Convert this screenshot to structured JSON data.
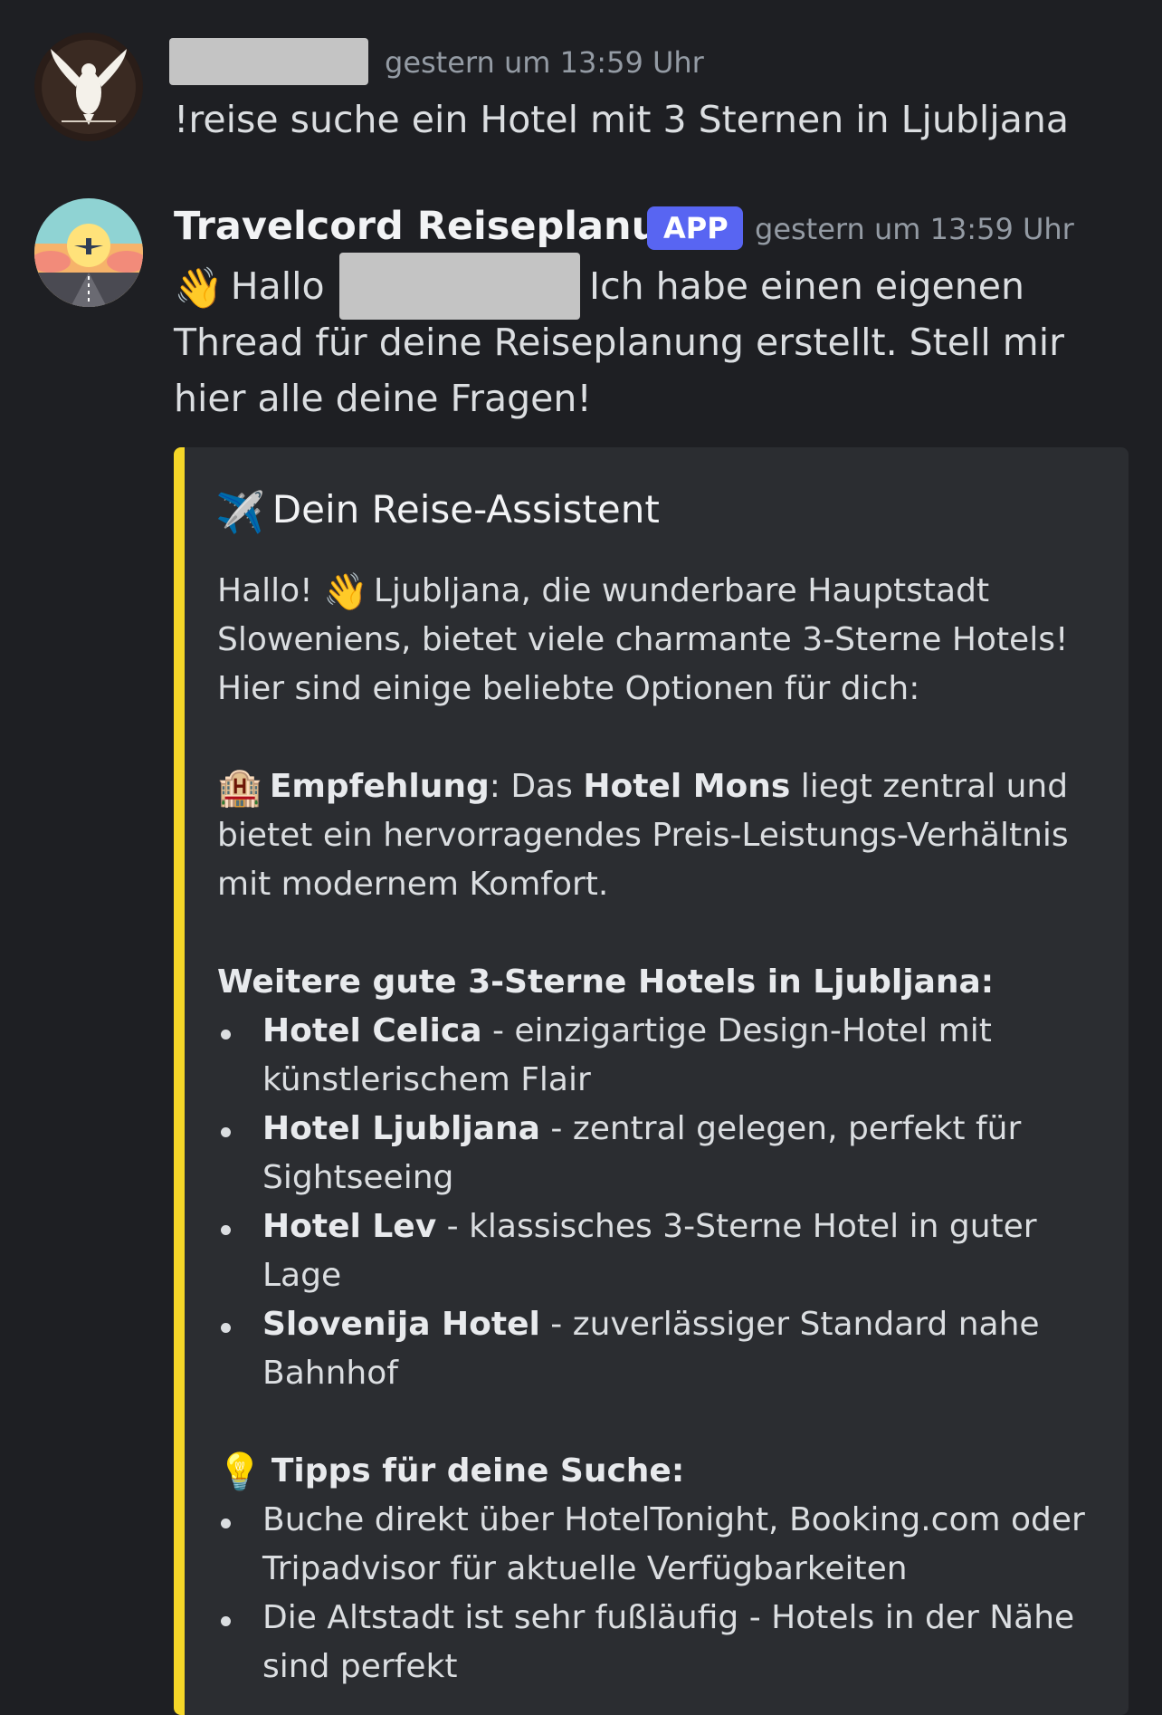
{
  "messages": [
    {
      "author": "",
      "author_redacted": true,
      "timestamp": "gestern um 13:59 Uhr",
      "text": "!reise suche ein Hotel mit 3 Sternen in Ljubljana"
    },
    {
      "author": "Travelcord Reiseplanung",
      "badge": "APP",
      "timestamp": "gestern um 13:59 Uhr",
      "line1_pre": "Hallo",
      "line1_post": "Ich habe einen eigenen",
      "line2": "Thread für deine Reiseplanung erstellt. Stell mir",
      "line3": "hier alle deine Fragen!"
    }
  ],
  "embed": {
    "accent_color": "#f5d628",
    "title": "Dein Reise-Assistent",
    "intro": [
      "Hallo! ",
      "Ljubljana, die wunderbare Hauptstadt",
      "Sloweniens, bietet viele charmante 3-Sterne Hotels!",
      "Hier sind einige beliebte Optionen für dich:"
    ],
    "recommendation": {
      "label": "Empfehlung",
      "pre": ": Das ",
      "hotel": "Hotel Mons",
      "post": " liegt zentral und",
      "line2": "bietet ein hervorragendes Preis-Leistungs-Verhältnis",
      "line3": "mit modernem Komfort."
    },
    "more_heading": "Weitere gute 3-Sterne Hotels in Ljubljana:",
    "hotels": [
      {
        "name": "Hotel Celica",
        "desc1": " - einzigartige Design-Hotel mit",
        "desc2": "künstlerischem Flair"
      },
      {
        "name": "Hotel Ljubljana",
        "desc1": " - zentral gelegen, perfekt für",
        "desc2": "Sightseeing"
      },
      {
        "name": "Hotel Lev",
        "desc1": " - klassisches 3-Sterne Hotel in guter",
        "desc2": "Lage"
      },
      {
        "name": "Slovenija Hotel",
        "desc1": " - zuverlässiger Standard nahe",
        "desc2": "Bahnhof"
      }
    ],
    "tips_heading": "Tipps für deine Suche:",
    "tips": [
      {
        "line1": "Buche direkt über HotelTonight, Booking.com oder",
        "line2": "Tripadvisor für aktuelle Verfügbarkeiten"
      },
      {
        "line1": "Die Altstadt ist sehr fußläufig - Hotels in der Nähe",
        "line2": "sind perfekt"
      }
    ]
  }
}
